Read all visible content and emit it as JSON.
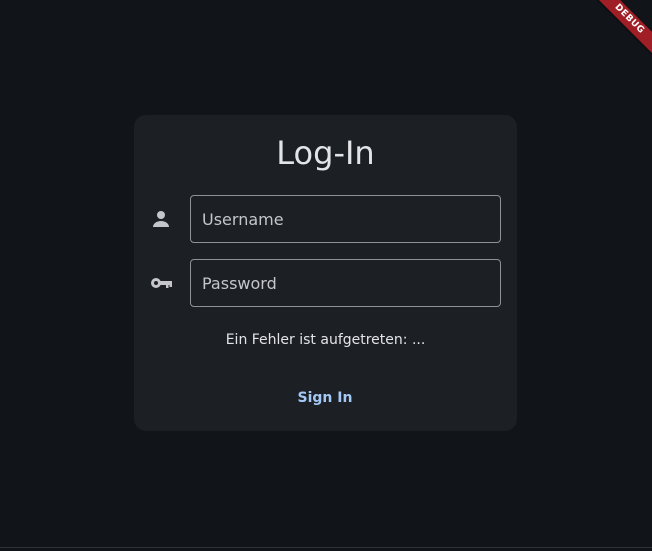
{
  "banner": {
    "label": "DEBUG",
    "color": "#a01e25"
  },
  "login": {
    "title": "Log-In",
    "username": {
      "placeholder": "Username",
      "value": "",
      "icon": "person-icon"
    },
    "password": {
      "placeholder": "Password",
      "value": "",
      "icon": "key-icon"
    },
    "error_message": "Ein Fehler ist aufgetreten: ...",
    "sign_in_label": "Sign In"
  },
  "colors": {
    "background": "#111418",
    "card": "#1c1f24",
    "accent": "#a3c8f5",
    "text": "#e3e4e8"
  }
}
